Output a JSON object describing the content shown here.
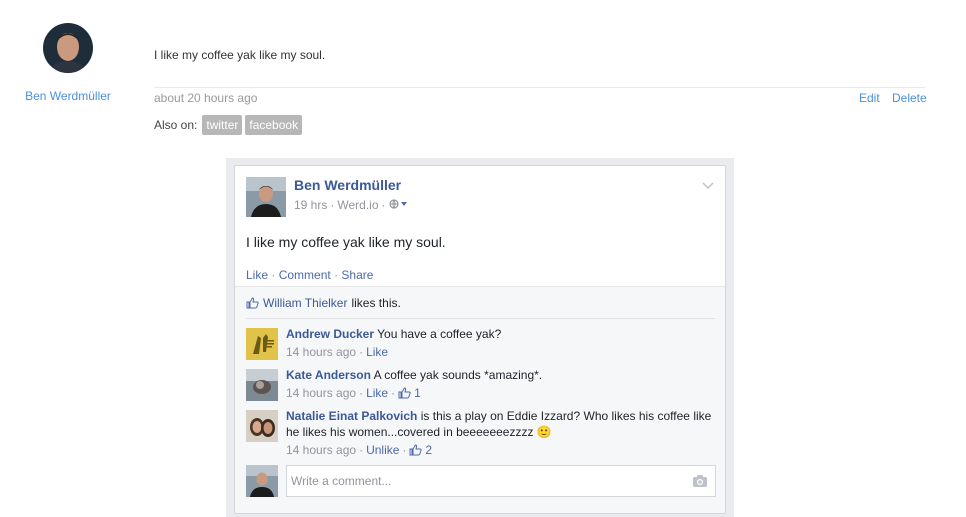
{
  "post": {
    "author_name": "Ben Werdmüller",
    "body": "I like my coffee yak like my soul.",
    "timestamp": "about 20 hours ago",
    "edit_label": "Edit",
    "delete_label": "Delete",
    "also_on_label": "Also on:",
    "syndication": [
      "twitter",
      "facebook"
    ]
  },
  "fb_embed": {
    "author_name": "Ben Werdmüller",
    "time": "19 hrs",
    "source": "Werd.io",
    "privacy_icon": "globe-icon",
    "text": "I like my coffee yak like my soul.",
    "actions": [
      "Like",
      "Comment",
      "Share"
    ],
    "likes": {
      "liker": "William Thielker",
      "suffix": "likes this."
    },
    "comments": [
      {
        "author": "Andrew Ducker",
        "text": "You have a coffee yak?",
        "time": "14 hours ago",
        "action": "Like",
        "like_count": ""
      },
      {
        "author": "Kate Anderson",
        "text": "A coffee yak sounds *amazing*.",
        "time": "14 hours ago",
        "action": "Like",
        "like_count": "1"
      },
      {
        "author": "Natalie Einat Palkovich",
        "text": "is this a play on Eddie Izzard? Who likes his coffee like he likes his women...covered in beeeeeeezzzz",
        "emoji": "🙂",
        "time": "14 hours ago",
        "action": "Unlike",
        "like_count": "2"
      }
    ],
    "write_placeholder": "Write a comment..."
  },
  "colors": {
    "known_link": "#4a90d9",
    "fb_blue": "#3b5998",
    "fb_link": "#4b6aa8",
    "tag_bg": "#b7b7b7"
  }
}
